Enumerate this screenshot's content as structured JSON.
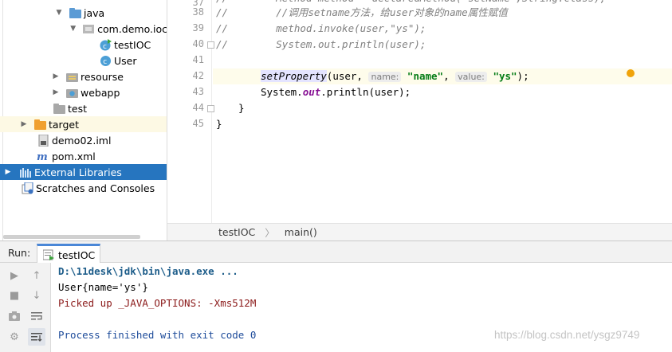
{
  "tree": {
    "items": [
      {
        "label": "java",
        "arrow": "open",
        "icon": "folder-blue-icon",
        "indent": 68
      },
      {
        "label": "com.demo.ioc",
        "arrow": "open",
        "icon": "package-icon",
        "indent": 88
      },
      {
        "label": "testIOC",
        "arrow": "none",
        "icon": "class-run-icon",
        "indent": 106
      },
      {
        "label": "User",
        "arrow": "none",
        "icon": "class-icon",
        "indent": 106
      },
      {
        "label": "resourse",
        "arrow": "closed",
        "icon": "folder-resources-icon",
        "indent": 68
      },
      {
        "label": "webapp",
        "arrow": "closed",
        "icon": "folder-web-icon",
        "indent": 68
      },
      {
        "label": "test",
        "arrow": "none",
        "icon": "folder-gray-icon",
        "indent": 48
      },
      {
        "label": "target",
        "arrow": "closed",
        "icon": "folder-orange-icon",
        "indent": 28
      },
      {
        "label": "demo02.iml",
        "arrow": "none",
        "icon": "iml-file-icon",
        "indent": 28
      },
      {
        "label": "pom.xml",
        "arrow": "none",
        "icon": "maven-icon",
        "indent": 28
      },
      {
        "label": "External Libraries",
        "arrow": "closed",
        "icon": "libraries-icon",
        "indent": 8
      },
      {
        "label": "Scratches and Consoles",
        "arrow": "none",
        "icon": "scratches-icon",
        "indent": 8
      }
    ]
  },
  "editor": {
    "line_numbers": [
      "37",
      "38",
      "39",
      "40",
      "41",
      "42",
      "43",
      "44",
      "45"
    ],
    "line37": "//        Method method = declaredMethod(\"setName\",String.class);",
    "line38_prefix": "//        ",
    "line38_comment": "//调用setname方法，给user对象的name属性赋值",
    "line39_prefix": "//        ",
    "line39_comment": "method.invoke(user,\"ys\");",
    "line40_prefix": "//        ",
    "line40_comment": "System.out.println(user);",
    "line42": {
      "method": "setProperty",
      "open": "(user, ",
      "hint1": "name:",
      "arg1": "\"name\"",
      "comma": ", ",
      "hint2": "value:",
      "arg2": "\"ys\"",
      "close": ");"
    },
    "line43": {
      "pre": "System.",
      "field": "out",
      "post": ".println(user);"
    },
    "line44": "}",
    "line45": "}"
  },
  "breadcrumb": {
    "class": "testIOC",
    "method": "main()",
    "separator": "〉"
  },
  "run": {
    "label": "Run:",
    "tab_label": "testIOC",
    "toolbar_icons": [
      "run-icon",
      "up-arrow-icon",
      "stop-icon",
      "down-arrow-icon",
      "camera-icon",
      "soft-wrap-icon",
      "settings-icon",
      "scroll-to-end-icon"
    ],
    "console": {
      "command": "D:\\11desk\\jdk\\bin\\java.exe ...",
      "output": "User{name='ys'}",
      "picked": "Picked up _JAVA_OPTIONS: -Xms512M",
      "exit": "Process finished with exit code 0"
    }
  },
  "watermark": "https://blog.csdn.net/ysgz9749",
  "colors": {
    "selection": "#2675bf",
    "string": "#067d17",
    "comment": "#808080",
    "field": "#871094",
    "tab_accent": "#4a87d7"
  }
}
